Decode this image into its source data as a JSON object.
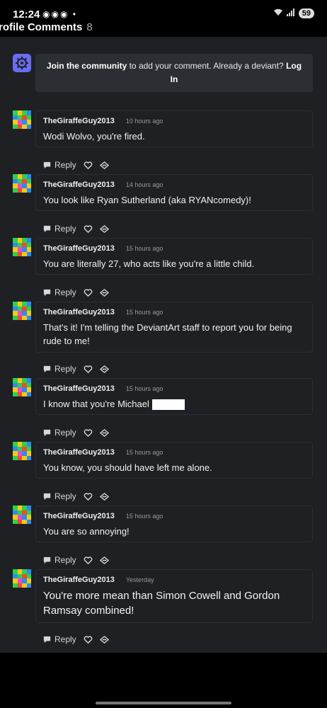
{
  "status_bar": {
    "time": "12:24",
    "battery": "59"
  },
  "section": {
    "title": "rofile Comments",
    "count": "8"
  },
  "join": {
    "link_text": "Join the community",
    "middle_text": " to add your comment. Already a deviant? ",
    "login_text": "Log In"
  },
  "reply_label": "Reply",
  "comments": [
    {
      "user": "TheGiraffeGuy2013",
      "time": "10 hours ago",
      "text": "Wodi Wolvo, you're fired."
    },
    {
      "user": "TheGiraffeGuy2013",
      "time": "14 hours ago",
      "text": "You look like Ryan Sutherland (aka RYANcomedy)!"
    },
    {
      "user": "TheGiraffeGuy2013",
      "time": "15 hours ago",
      "text": "You are literally 27, who acts like you're a little child."
    },
    {
      "user": "TheGiraffeGuy2013",
      "time": "15 hours ago",
      "text": "That's it! I'm telling the DeviantArt staff to report you for being rude to me!"
    },
    {
      "user": "TheGiraffeGuy2013",
      "time": "15 hours ago",
      "text": "I know that you're Michael"
    },
    {
      "user": "TheGiraffeGuy2013",
      "time": "15 hours ago",
      "text": "You know, you should have left me alone."
    },
    {
      "user": "TheGiraffeGuy2013",
      "time": "15 hours ago",
      "text": "You are so annoying!"
    },
    {
      "user": "TheGiraffeGuy2013",
      "time": "Yesterday",
      "text": "You're more mean than Simon Cowell and Gordon Ramsay combined!"
    }
  ]
}
